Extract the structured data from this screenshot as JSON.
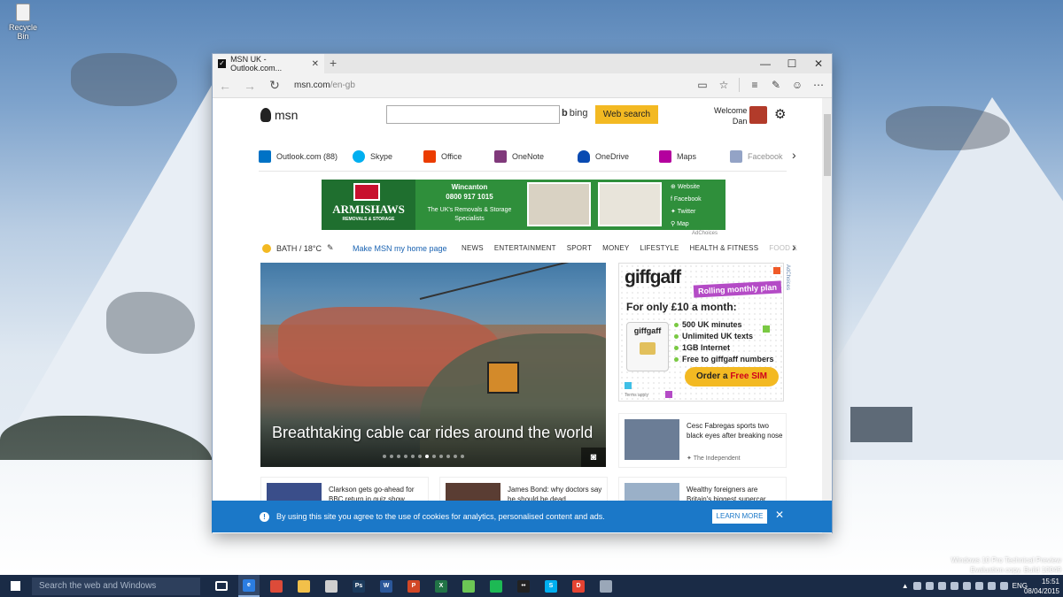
{
  "desktop": {
    "recycle_bin_label": "Recycle Bin",
    "watermark_line1": "Windows 10 Pro Technical Preview",
    "watermark_line2": "Evaluation copy. Build 10049"
  },
  "browser": {
    "tab_title": "MSN UK - Outlook.com...",
    "tab_close": "✕",
    "new_tab": "+",
    "url_host": "msn.com",
    "url_path": "/en-gb",
    "window_controls": {
      "minimize": "—",
      "maximize": "☐",
      "close": "✕"
    }
  },
  "msn": {
    "logo_text": "msn",
    "search_placeholder": "",
    "bing_label": "bing",
    "web_search_label": "Web search",
    "welcome_label": "Welcome",
    "user_name": "Dan",
    "apps": [
      {
        "label": "Outlook.com (88)",
        "color": "#0072c6"
      },
      {
        "label": "Skype",
        "color": "#00aff0"
      },
      {
        "label": "Office",
        "color": "#eb3c00"
      },
      {
        "label": "OneNote",
        "color": "#80397b"
      },
      {
        "label": "OneDrive",
        "color": "#094ab2"
      },
      {
        "label": "Maps",
        "color": "#b4009e"
      },
      {
        "label": "Facebook",
        "color": "#3b5998"
      }
    ],
    "ad_top": {
      "brand": "ARMISHAWS",
      "brand_sub": "REMOVALS & STORAGE",
      "location": "Wincanton",
      "phone": "0800 917 1015",
      "tagline": "The UK's Removals & Storage Specialists",
      "links": [
        "Website",
        "Facebook",
        "Twitter",
        "Map"
      ],
      "adchoices": "AdChoices"
    },
    "weather": "BATH / 18°C",
    "make_home": "Make MSN my home page",
    "nav": [
      "NEWS",
      "ENTERTAINMENT",
      "SPORT",
      "MONEY",
      "LIFESTYLE",
      "HEALTH & FITNESS",
      "FOOD &"
    ],
    "hero_title": "Breathtaking cable car rides around the world",
    "hero_slides_total": 12,
    "hero_slide_active": 6,
    "giffgaff": {
      "logo": "giffgaff",
      "plan_badge": "Rolling monthly plan",
      "offer": "For only £10 a month:",
      "sim_label": "giffgaff",
      "features": [
        "500 UK minutes",
        "Unlimited UK texts",
        "1GB Internet",
        "Free to giffgaff numbers"
      ],
      "cta_prefix": "Order a ",
      "cta_emph": "Free SIM",
      "terms": "Terms apply",
      "adchoices": "AdChoices"
    },
    "side_news": {
      "title": "Cesc Fabregas sports two black eyes after breaking nose",
      "source": "The Independent"
    },
    "bottom_news": [
      {
        "title": "Clarkson gets go-ahead for BBC return in quiz show"
      },
      {
        "title": "James Bond: why doctors say he should be dead"
      },
      {
        "title": "Wealthy foreigners are Britain's biggest supercar"
      }
    ],
    "cookie_text": "By using this site you agree to the use of cookies for analytics, personalised content and ads.",
    "cookie_learn_more": "LEARN MORE",
    "cookie_close": "✕"
  },
  "taskbar": {
    "search_placeholder": "Search the web and Windows",
    "apps": [
      {
        "name": "task-view",
        "color": "#ffffff",
        "glyph": ""
      },
      {
        "name": "edge",
        "color": "#2b7de1",
        "glyph": "e"
      },
      {
        "name": "chrome",
        "color": "#dd4b39",
        "glyph": ""
      },
      {
        "name": "file-explorer",
        "color": "#f2c04a",
        "glyph": ""
      },
      {
        "name": "store",
        "color": "#cfcfcf",
        "glyph": ""
      },
      {
        "name": "photoshop",
        "color": "#1b3a5c",
        "glyph": "Ps"
      },
      {
        "name": "word",
        "color": "#2b579a",
        "glyph": "W"
      },
      {
        "name": "powerpoint",
        "color": "#d24726",
        "glyph": "P"
      },
      {
        "name": "excel",
        "color": "#217346",
        "glyph": "X"
      },
      {
        "name": "feedly",
        "color": "#6cc655",
        "glyph": ""
      },
      {
        "name": "spotify",
        "color": "#1db954",
        "glyph": ""
      },
      {
        "name": "app-dark",
        "color": "#222222",
        "glyph": "••"
      },
      {
        "name": "skype",
        "color": "#00aff0",
        "glyph": "S"
      },
      {
        "name": "todoist",
        "color": "#e44332",
        "glyph": "D"
      },
      {
        "name": "app-misc",
        "color": "#9aa7b8",
        "glyph": ""
      }
    ],
    "language": "ENG",
    "time": "15:51",
    "date": "08/04/2015"
  }
}
